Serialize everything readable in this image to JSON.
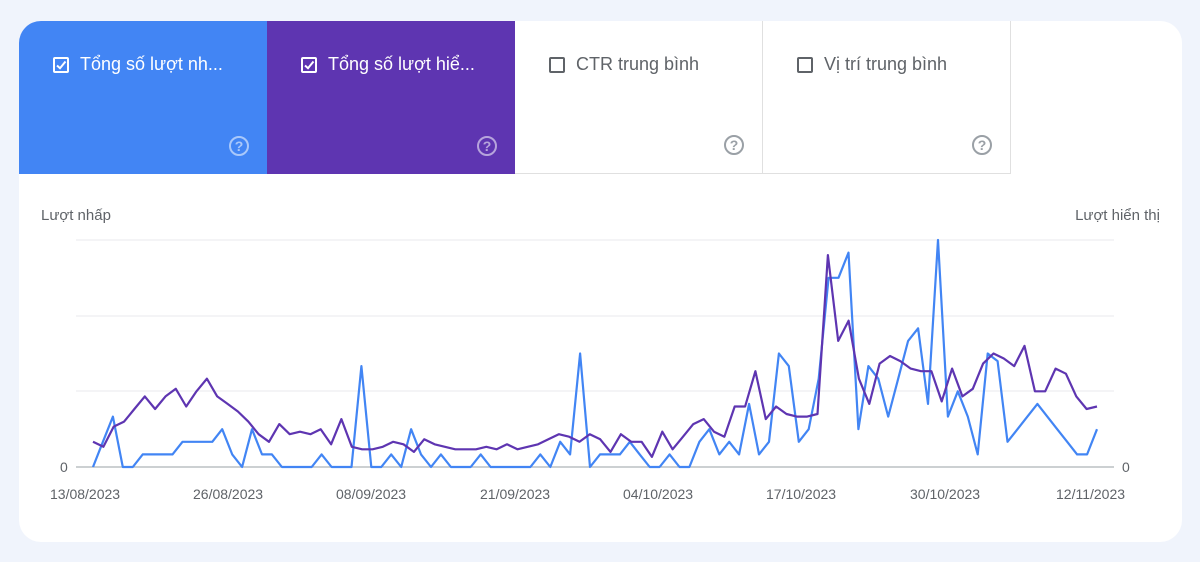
{
  "tabs": [
    {
      "label": "Tổng số lượt nh...",
      "checked": true,
      "color": "#4285f4",
      "help_icon": "help-circle-icon"
    },
    {
      "label": "Tổng số lượt hiể...",
      "checked": true,
      "color": "#5e35b1",
      "help_icon": "help-circle-icon"
    },
    {
      "label": "CTR trung bình",
      "checked": false,
      "help_icon": "help-circle-icon"
    },
    {
      "label": "Vị trí trung bình",
      "checked": false,
      "help_icon": "help-circle-icon"
    }
  ],
  "help_glyph": "?",
  "chart_data": {
    "type": "line",
    "y_left_label": "Lượt nhấp",
    "y_right_label": "Lượt hiển thị",
    "y_left_ticks": [
      "0"
    ],
    "y_right_ticks": [
      "0"
    ],
    "x_start": "13/08/2023",
    "x_end": "14/11/2023",
    "x_tick_labels": [
      "13/08/2023",
      "26/08/2023",
      "08/09/2023",
      "21/09/2023",
      "04/10/2023",
      "17/10/2023",
      "30/10/2023",
      "12/11/2023"
    ],
    "grid": true,
    "series": [
      {
        "axis": "left",
        "color": "#4285f4",
        "values": [
          0,
          1,
          2,
          0,
          0,
          0.5,
          0.5,
          0.5,
          0.5,
          1,
          1,
          1,
          1,
          1.5,
          0.5,
          0,
          1.5,
          0.5,
          0.5,
          0,
          0,
          0,
          0,
          0.5,
          0,
          0,
          0,
          4,
          0,
          0,
          0.5,
          0,
          1.5,
          0.5,
          0,
          0.5,
          0,
          0,
          0,
          0.5,
          0,
          0,
          0,
          0,
          0,
          0.5,
          0,
          1,
          0.5,
          4.5,
          0,
          0.5,
          0.5,
          0.5,
          1,
          0.5,
          0,
          0,
          0.5,
          0,
          0,
          1,
          1.5,
          0.5,
          1,
          0.5,
          2.5,
          0.5,
          1,
          4.5,
          4,
          1,
          1.5,
          3.5,
          7.5,
          7.5,
          8.5,
          1.5,
          4,
          3.5,
          2,
          3.5,
          5,
          5.5,
          2.5,
          9,
          2,
          3,
          2,
          0.5,
          4.5,
          4.2,
          1,
          1.5,
          2,
          2.5,
          2,
          1.5,
          1,
          0.5,
          0.5,
          1.5
        ]
      },
      {
        "axis": "right",
        "color": "#5e35b1",
        "values": [
          1,
          0.8,
          1.6,
          1.8,
          2.3,
          2.8,
          2.3,
          2.8,
          3.1,
          2.4,
          3,
          3.5,
          2.8,
          2.5,
          2.2,
          1.8,
          1.3,
          1,
          1.7,
          1.3,
          1.4,
          1.3,
          1.5,
          0.9,
          1.9,
          0.8,
          0.7,
          0.7,
          0.8,
          1,
          0.9,
          0.6,
          1.1,
          0.9,
          0.8,
          0.7,
          0.7,
          0.7,
          0.8,
          0.7,
          0.9,
          0.7,
          0.8,
          0.9,
          1.1,
          1.3,
          1.2,
          1,
          1.3,
          1.1,
          0.6,
          1.3,
          1,
          1,
          0.4,
          1.4,
          0.7,
          1.2,
          1.7,
          1.9,
          1.4,
          1.2,
          2.4,
          2.4,
          3.8,
          1.9,
          2.4,
          2.1,
          2.0,
          2.0,
          2.1,
          8.4,
          5.0,
          5.8,
          3.5,
          2.5,
          4.1,
          4.4,
          4.2,
          3.9,
          3.8,
          3.8,
          2.6,
          3.9,
          2.8,
          3.1,
          4.1,
          4.5,
          4.3,
          4.0,
          4.8,
          3.0,
          3.0,
          3.9,
          3.7,
          2.8,
          2.3,
          2.4
        ]
      }
    ]
  }
}
